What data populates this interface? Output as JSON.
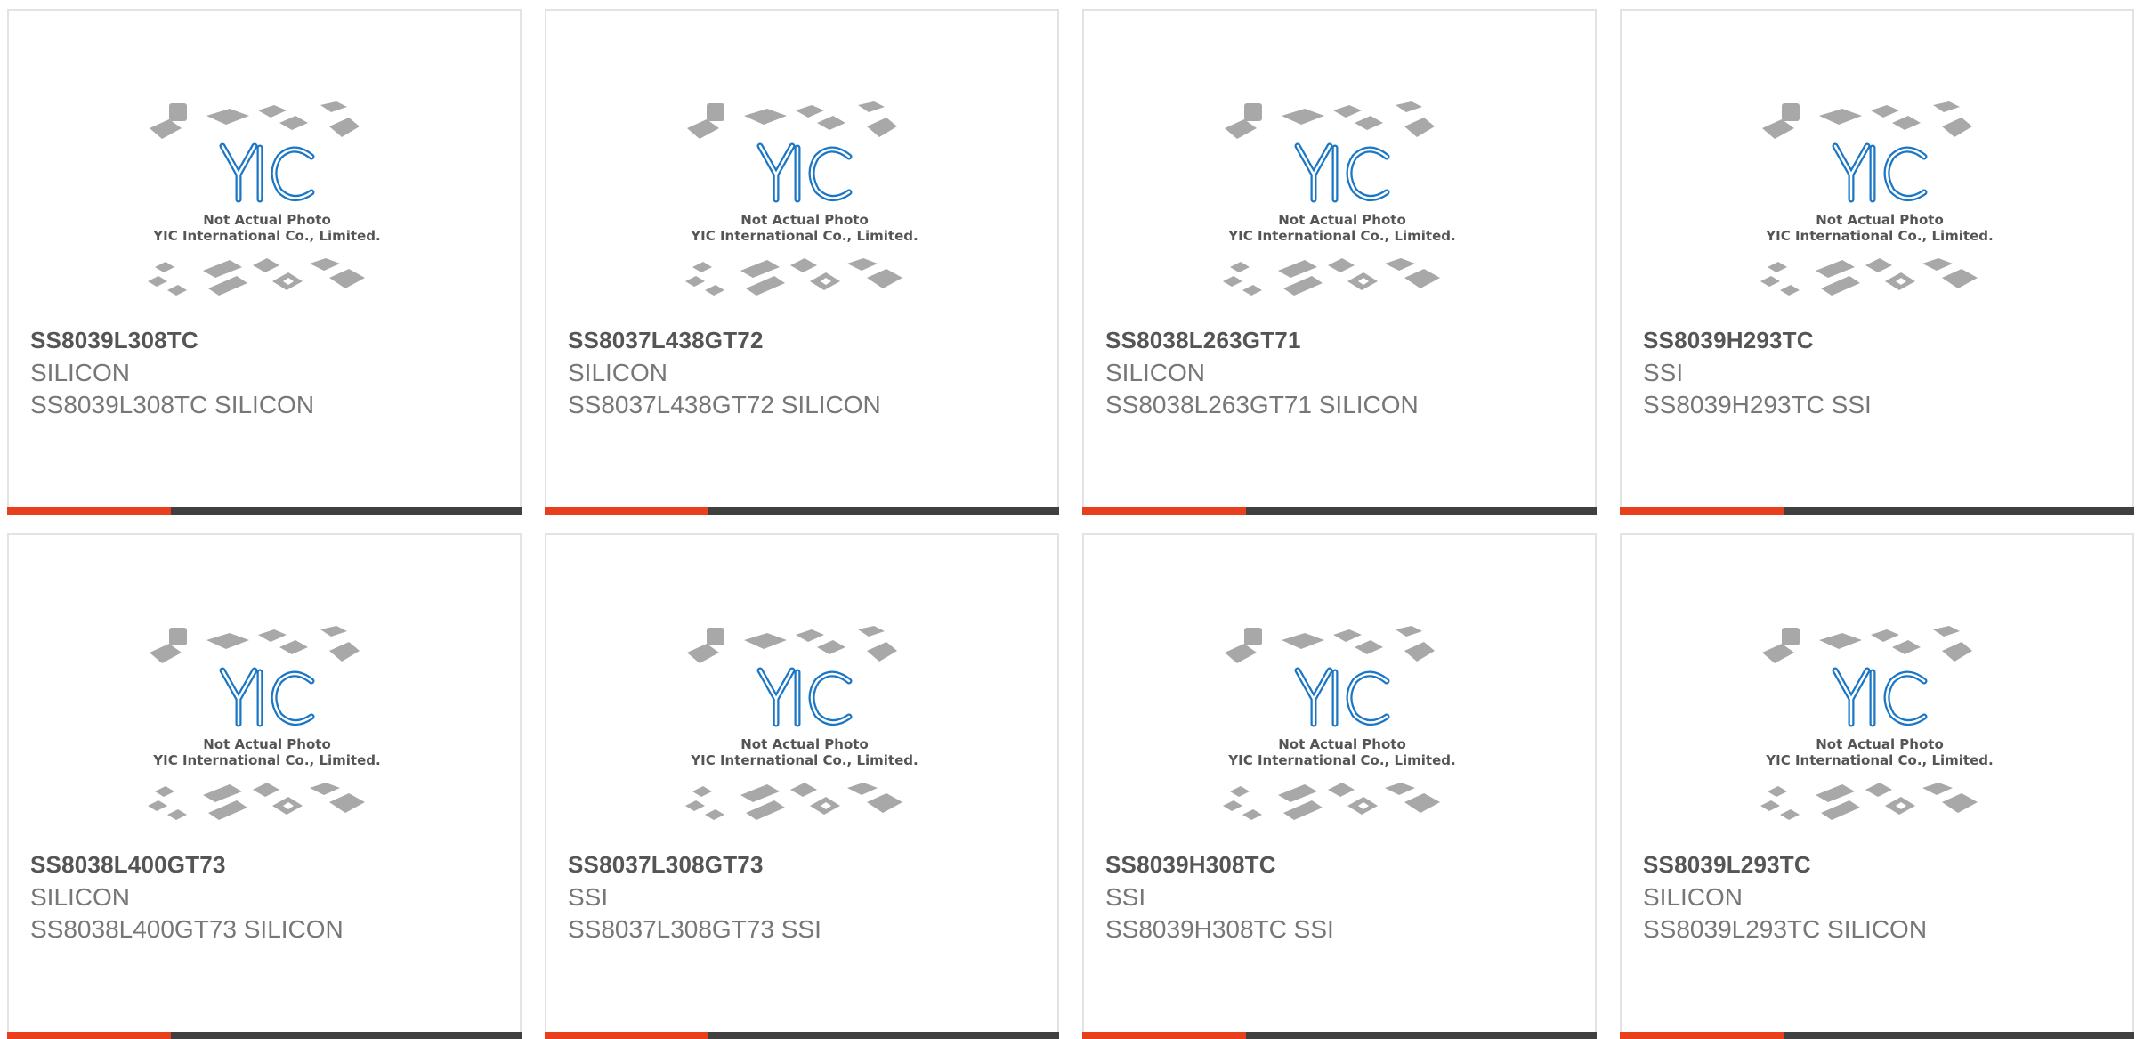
{
  "accent_color": "#e8401c",
  "bar_color": "#404040",
  "placeholder": {
    "line1": "Not Actual Photo",
    "line2": "YIC International Co., Limited.",
    "logo_color": "#1b77c5",
    "chip_color": "#a8a8a8"
  },
  "products": [
    {
      "part": "SS8039L308TC",
      "mfr": "SILICON",
      "desc": "SS8039L308TC SILICON"
    },
    {
      "part": "SS8037L438GT72",
      "mfr": "SILICON",
      "desc": "SS8037L438GT72 SILICON"
    },
    {
      "part": "SS8038L263GT71",
      "mfr": "SILICON",
      "desc": "SS8038L263GT71 SILICON"
    },
    {
      "part": "SS8039H293TC",
      "mfr": "SSI",
      "desc": "SS8039H293TC SSI"
    },
    {
      "part": "SS8038L400GT73",
      "mfr": "SILICON",
      "desc": "SS8038L400GT73 SILICON"
    },
    {
      "part": "SS8037L308GT73",
      "mfr": "SSI",
      "desc": "SS8037L308GT73 SSI"
    },
    {
      "part": "SS8039H308TC",
      "mfr": "SSI",
      "desc": "SS8039H308TC SSI"
    },
    {
      "part": "SS8039L293TC",
      "mfr": "SILICON",
      "desc": "SS8039L293TC SILICON"
    }
  ]
}
